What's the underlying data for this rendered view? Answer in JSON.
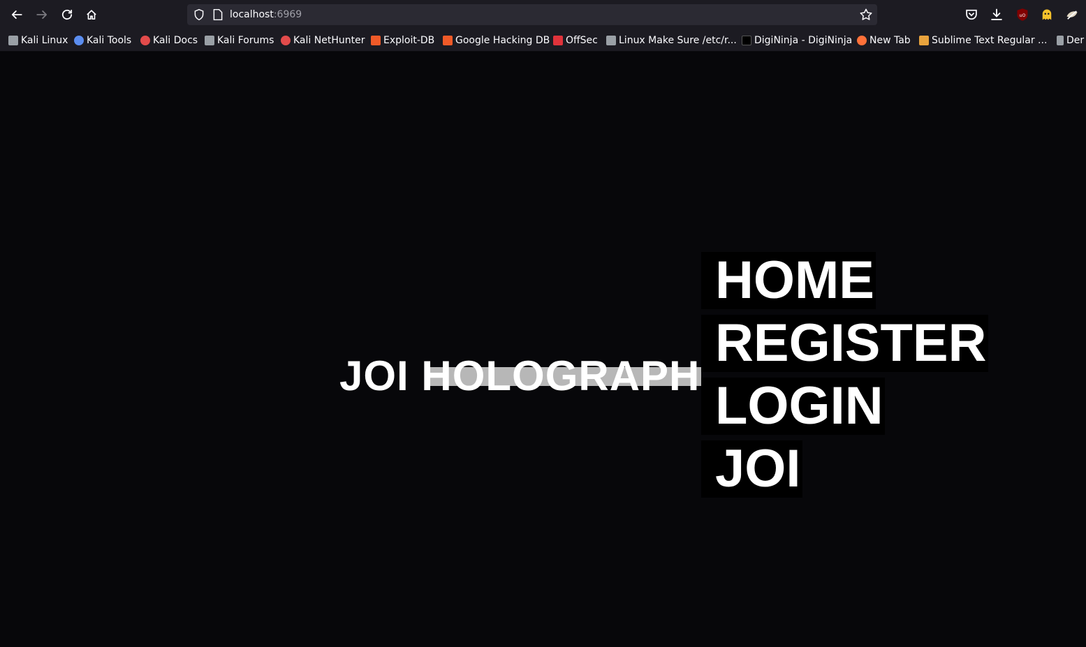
{
  "browser": {
    "url_host": "localhost",
    "url_port": ":6969",
    "nav": {
      "back_icon": "arrow-left-icon",
      "forward_icon": "arrow-right-icon",
      "reload_icon": "reload-icon",
      "home_icon": "home-icon"
    },
    "bookmarks": [
      {
        "label": "Kali Linux",
        "icon": "kali-dragon-icon",
        "color": "#9aa0a6"
      },
      {
        "label": "Kali Tools",
        "icon": "kali-tools-icon",
        "color": "#5b8def"
      },
      {
        "label": "Kali Docs",
        "icon": "kali-docs-icon",
        "color": "#e24b4b"
      },
      {
        "label": "Kali Forums",
        "icon": "kali-forums-icon",
        "color": "#9aa0a6"
      },
      {
        "label": "Kali NetHunter",
        "icon": "nethunter-icon",
        "color": "#e24b4b"
      },
      {
        "label": "Exploit-DB",
        "icon": "exploit-db-icon",
        "color": "#f05a28"
      },
      {
        "label": "Google Hacking DB",
        "icon": "ghdb-icon",
        "color": "#f05a28"
      },
      {
        "label": "OffSec",
        "icon": "offsec-icon",
        "color": "#e0333b"
      },
      {
        "label": "Linux Make Sure /etc/r...",
        "icon": "linux-icon",
        "color": "#9aa0a6"
      },
      {
        "label": "DigiNinja - DigiNinja",
        "icon": "digininja-icon",
        "color": "#000000"
      },
      {
        "label": "New Tab",
        "icon": "firefox-icon",
        "color": "#ff7139"
      },
      {
        "label": "Sublime Text Regular ...",
        "icon": "regex-icon",
        "color": "#e8a33d"
      },
      {
        "label": "Der",
        "icon": "der-icon",
        "color": "#9aa0a6"
      }
    ]
  },
  "page": {
    "brand": "JOI HOLOGRAPH",
    "menu": [
      "HOME",
      "REGISTER",
      "LOGIN",
      "JOI"
    ]
  }
}
